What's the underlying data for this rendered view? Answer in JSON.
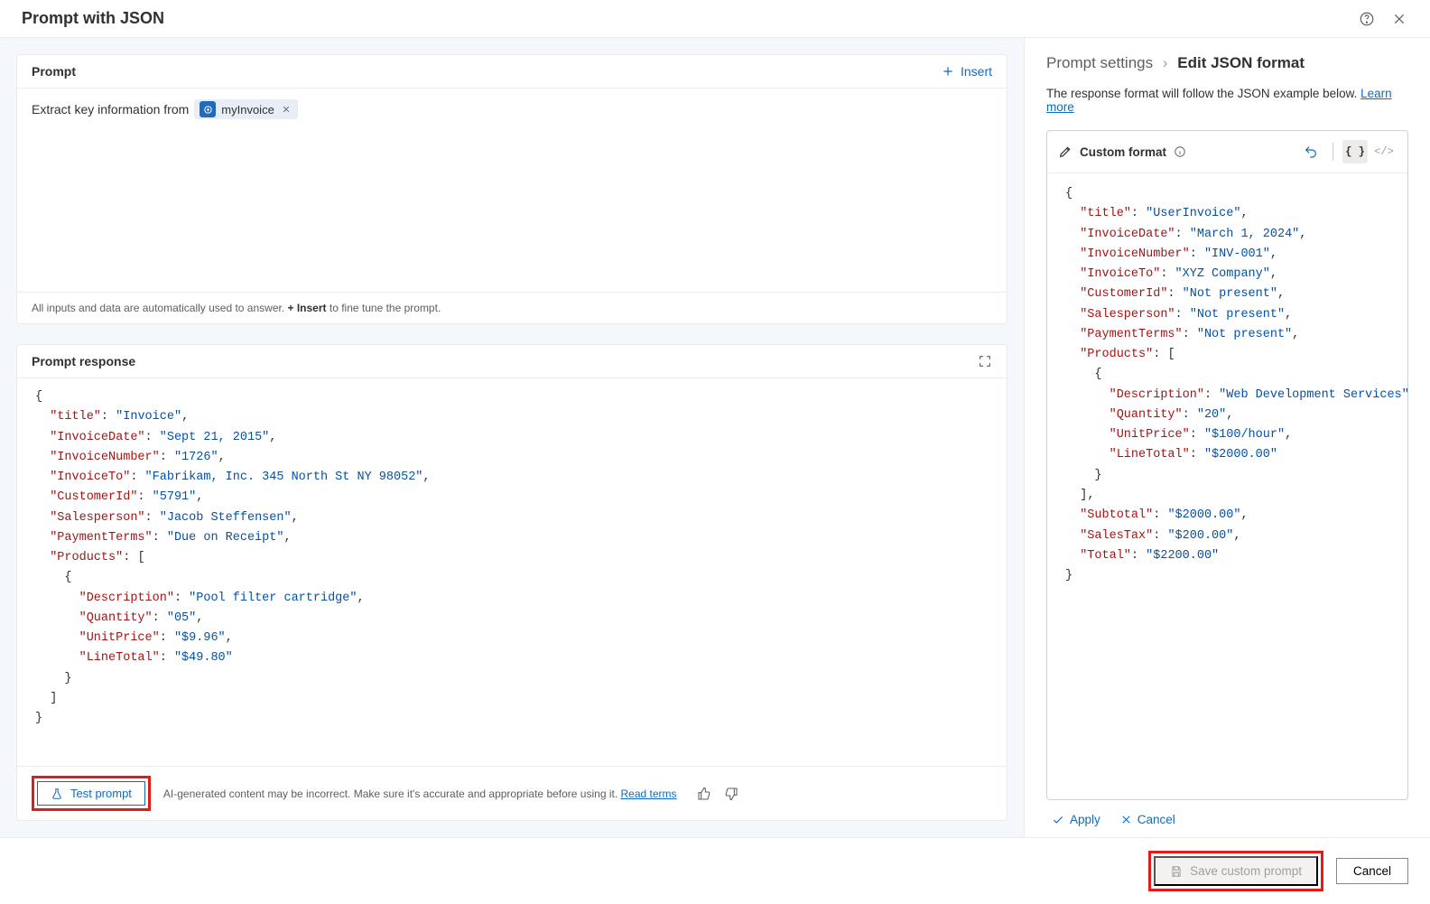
{
  "header": {
    "title": "Prompt with JSON"
  },
  "prompt": {
    "section_label": "Prompt",
    "insert_label": "Insert",
    "text_prefix": "Extract key information from",
    "chip_label": "myInvoice",
    "hint_prefix": "All inputs and data are automatically used to answer. ",
    "hint_bold": "+ Insert",
    "hint_suffix": " to fine tune the prompt."
  },
  "response": {
    "section_label": "Prompt response",
    "test_button": "Test prompt",
    "disclaimer": "AI-generated content may be incorrect. Make sure it's accurate and appropriate before using it. ",
    "read_terms": "Read terms",
    "json": {
      "title": "Invoice",
      "InvoiceDate": "Sept 21, 2015",
      "InvoiceNumber": "1726",
      "InvoiceTo": "Fabrikam, Inc. 345 North St NY 98052",
      "CustomerId": "5791",
      "Salesperson": "Jacob Steffensen",
      "PaymentTerms": "Due on Receipt",
      "Products": [
        {
          "Description": "Pool filter cartridge",
          "Quantity": "05",
          "UnitPrice": "$9.96",
          "LineTotal": "$49.80"
        }
      ]
    }
  },
  "settings": {
    "crumb1": "Prompt settings",
    "crumb2": "Edit JSON format",
    "description": "The response format will follow the JSON example below. ",
    "learn_more": "Learn more",
    "format_label": "Custom format",
    "apply": "Apply",
    "cancel": "Cancel",
    "json": {
      "title": "UserInvoice",
      "InvoiceDate": "March 1, 2024",
      "InvoiceNumber": "INV-001",
      "InvoiceTo": "XYZ Company",
      "CustomerId": "Not present",
      "Salesperson": "Not present",
      "PaymentTerms": "Not present",
      "Products": [
        {
          "Description": "Web Development Services",
          "Quantity": "20",
          "UnitPrice": "$100/hour",
          "LineTotal": "$2000.00"
        }
      ],
      "Subtotal": "$2000.00",
      "SalesTax": "$200.00",
      "Total": "$2200.00"
    }
  },
  "footer": {
    "save": "Save custom prompt",
    "cancel": "Cancel"
  }
}
